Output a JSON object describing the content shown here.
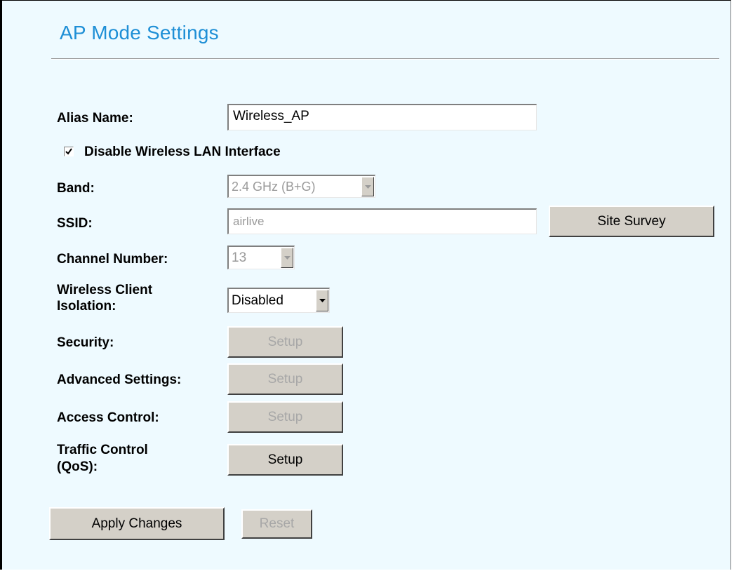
{
  "page": {
    "title": "AP Mode Settings"
  },
  "form": {
    "alias_label": "Alias Name:",
    "alias_value": "Wireless_AP",
    "disable_label": "Disable Wireless LAN Interface",
    "disable_checked": true,
    "band_label": "Band:",
    "band_value": "2.4 GHz (B+G)",
    "ssid_label": "SSID:",
    "ssid_value": "airlive",
    "site_survey_label": "Site Survey",
    "channel_label": "Channel Number:",
    "channel_value": "13",
    "isolation_label_line1": "Wireless Client",
    "isolation_label_line2": "Isolation:",
    "isolation_value": "Disabled",
    "security_label": "Security:",
    "advanced_label": "Advanced Settings:",
    "access_label": "Access Control:",
    "traffic_label_line1": "Traffic Control",
    "traffic_label_line2": "(QoS):",
    "setup_label": "Setup"
  },
  "actions": {
    "apply_label": "Apply Changes",
    "reset_label": "Reset"
  },
  "colors": {
    "background": "#eefaff",
    "title": "#1e8fd6",
    "button_face": "#d4d0c8",
    "disabled_text": "#9a9a9a"
  }
}
